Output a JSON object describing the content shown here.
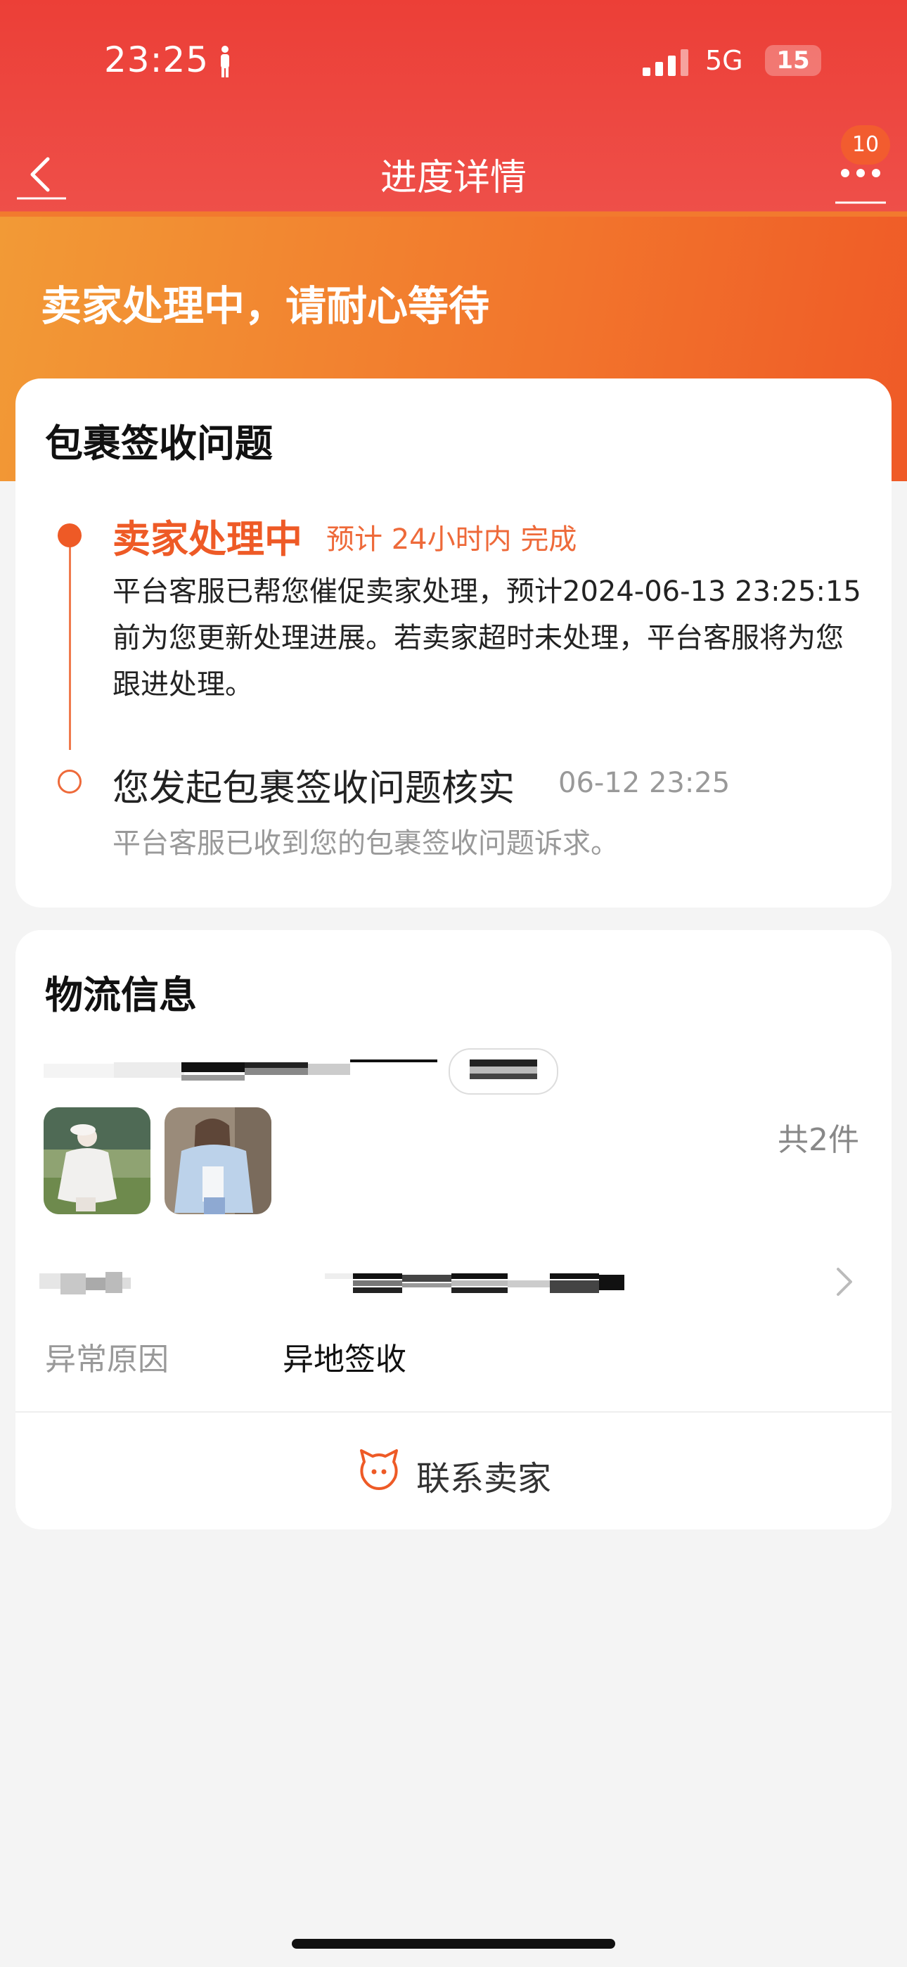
{
  "status_bar": {
    "time": "23:25",
    "network": "5G",
    "battery": "15"
  },
  "nav": {
    "title": "进度详情",
    "badge_count": "10"
  },
  "hero": {
    "status_text": "卖家处理中，请耐心等待"
  },
  "issue_card": {
    "title": "包裹签收问题",
    "steps": [
      {
        "title": "卖家处理中",
        "eta": "预计 24小时内 完成",
        "description": "平台客服已帮您催促卖家处理，预计2024-06-13 23:25:15前为您更新处理进展。若卖家超时未处理，平台客服将为您跟进处理。"
      },
      {
        "title": "您发起包裹签收问题核实",
        "time": "06-12 23:25",
        "description": "平台客服已收到您的包裹签收问题诉求。"
      }
    ]
  },
  "logistics_card": {
    "title": "物流信息",
    "item_count": "共2件",
    "abnormal_reason_label": "异常原因",
    "abnormal_reason_value": "异地签收",
    "contact_seller": "联系卖家"
  },
  "colors": {
    "accent": "#ee5a26",
    "header_red": "#ec3f37",
    "background": "#f4f4f4"
  }
}
